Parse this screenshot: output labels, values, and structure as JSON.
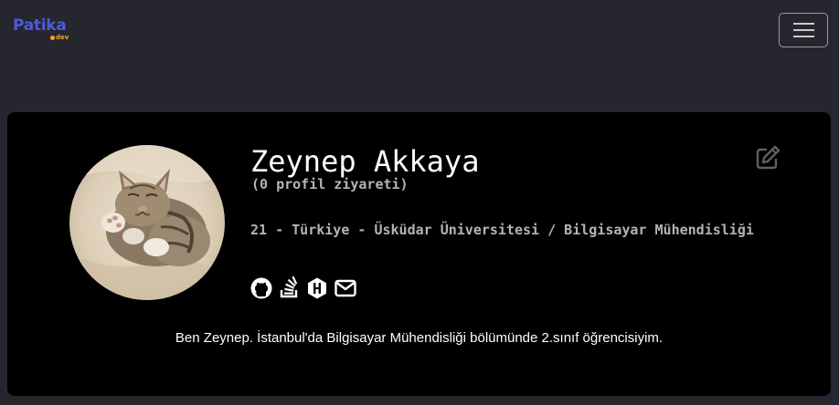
{
  "navbar": {
    "brand": "Patika",
    "brand_sub": "dev",
    "brand_color": "#4f5bd5",
    "brand_accent": "#f5a623",
    "menu_icon": "hamburger-menu-icon"
  },
  "profile": {
    "name": "Zeynep Akkaya",
    "visits": "(0 profil ziyareti)",
    "info": "21 - Türkiye - Üsküdar Üniversitesi / Bilgisayar Mühendisliği",
    "bio": "Ben Zeynep. İstanbul'da Bilgisayar Mühendisliği bölümünde 2.sınıf öğrencisiyim.",
    "avatar": "kitten-photo",
    "edit_icon": "edit-icon",
    "social_icons": [
      "github-icon",
      "stackoverflow-icon",
      "hackerrank-icon",
      "email-icon"
    ]
  },
  "colors": {
    "page_bg": "#26262f",
    "card_bg": "#000000",
    "text_primary": "#ffffff",
    "text_muted": "#b4b4b8"
  }
}
